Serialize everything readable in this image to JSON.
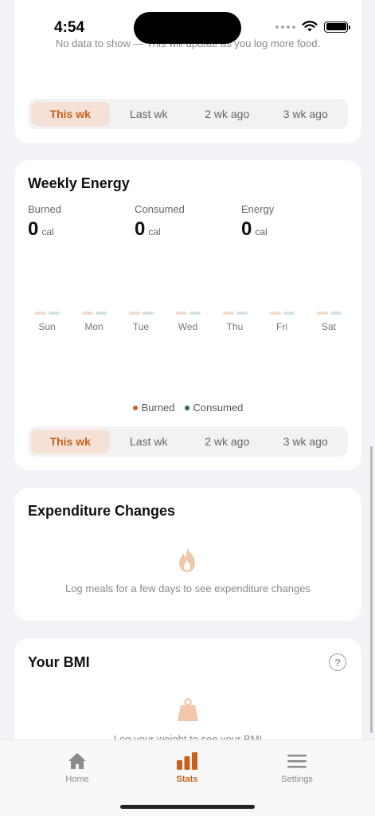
{
  "status_bar": {
    "time": "4:54"
  },
  "top_card": {
    "no_data": "No data to show — This will update as you log more food.",
    "segments": [
      "This wk",
      "Last wk",
      "2 wk ago",
      "3 wk ago"
    ],
    "active_segment": 0
  },
  "weekly_energy": {
    "title": "Weekly Energy",
    "stats": [
      {
        "label": "Burned",
        "value": "0",
        "unit": "cal"
      },
      {
        "label": "Consumed",
        "value": "0",
        "unit": "cal"
      },
      {
        "label": "Energy",
        "value": "0",
        "unit": "cal"
      }
    ],
    "days": [
      "Sun",
      "Mon",
      "Tue",
      "Wed",
      "Thu",
      "Fri",
      "Sat"
    ],
    "legend": [
      {
        "label": "Burned",
        "color": "#c8621a"
      },
      {
        "label": "Consumed",
        "color": "#2f6b52"
      }
    ],
    "segments": [
      "This wk",
      "Last wk",
      "2 wk ago",
      "3 wk ago"
    ],
    "active_segment": 0
  },
  "expenditure": {
    "title": "Expenditure Changes",
    "empty_text": "Log meals for a few days to see expenditure changes",
    "icon": "flame-icon"
  },
  "bmi": {
    "title": "Your BMI",
    "empty_text": "Log your weight to see your BMI",
    "icon": "weight-icon",
    "help": "?"
  },
  "tabbar": {
    "tabs": [
      {
        "label": "Home",
        "icon": "home-icon"
      },
      {
        "label": "Stats",
        "icon": "stats-icon"
      },
      {
        "label": "Settings",
        "icon": "settings-icon"
      }
    ],
    "active": 1
  },
  "colors": {
    "accent": "#c8621a",
    "consumed": "#2f6b52"
  }
}
